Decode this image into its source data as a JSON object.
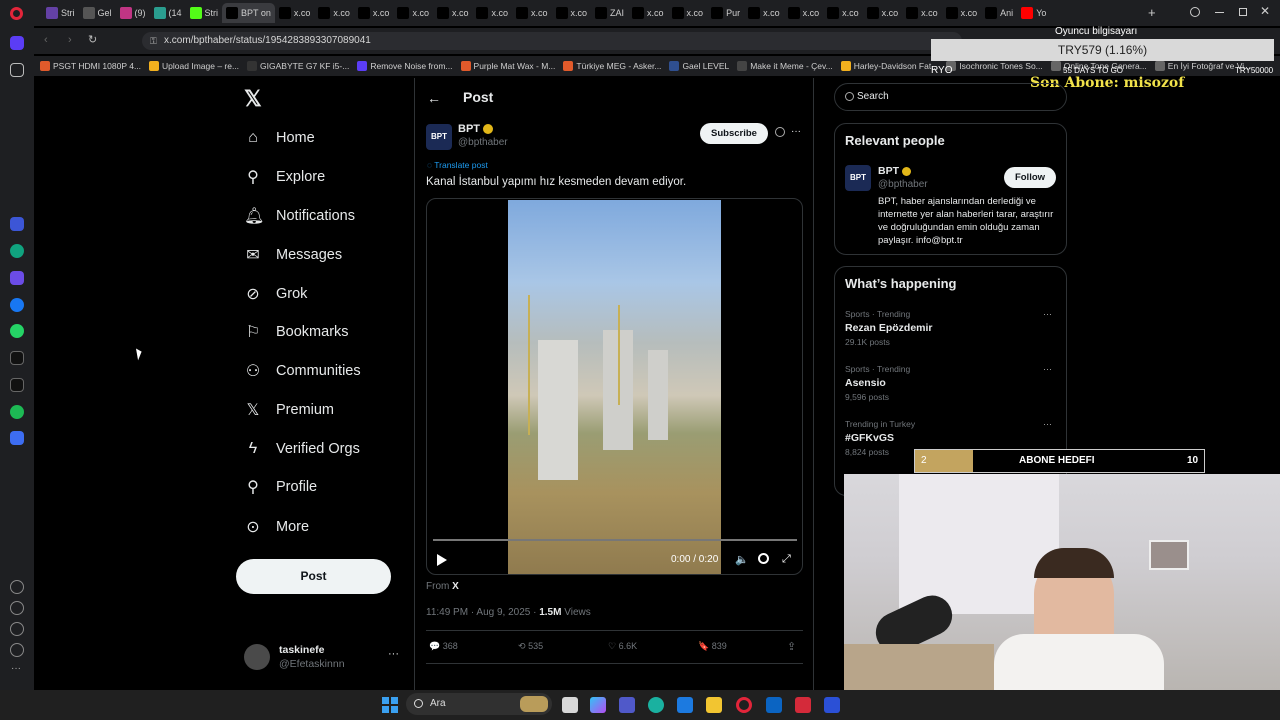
{
  "browser": {
    "tabs": [
      {
        "label": "Stri",
        "color": "#6441a5"
      },
      {
        "label": "Gel",
        "color": "#555"
      },
      {
        "label": "(9)",
        "color": "#c13584"
      },
      {
        "label": "(14",
        "color": "#2a9d8f"
      },
      {
        "label": "Stri",
        "color": "#53fc18"
      },
      {
        "label": "BPT on",
        "color": "#000"
      },
      {
        "label": "x.co",
        "color": "#000"
      },
      {
        "label": "x.co",
        "color": "#000"
      },
      {
        "label": "x.co",
        "color": "#000"
      },
      {
        "label": "x.co",
        "color": "#000"
      },
      {
        "label": "x.co",
        "color": "#000"
      },
      {
        "label": "x.co",
        "color": "#000"
      },
      {
        "label": "x.co",
        "color": "#000"
      },
      {
        "label": "x.co",
        "color": "#000"
      },
      {
        "label": "ZAI",
        "color": "#000"
      },
      {
        "label": "x.co",
        "color": "#000"
      },
      {
        "label": "x.co",
        "color": "#000"
      },
      {
        "label": "Pur",
        "color": "#000"
      },
      {
        "label": "x.co",
        "color": "#000"
      },
      {
        "label": "x.co",
        "color": "#000"
      },
      {
        "label": "x.co",
        "color": "#000"
      },
      {
        "label": "x.co",
        "color": "#000"
      },
      {
        "label": "x.co",
        "color": "#000"
      },
      {
        "label": "x.co",
        "color": "#000"
      },
      {
        "label": "Ani",
        "color": "#000"
      },
      {
        "label": "Yo",
        "color": "#ff0000"
      }
    ],
    "url": "x.com/bpthaber/status/1954283893307089041",
    "bookmarks": [
      {
        "label": "PSGT HDMI 1080P 4...",
        "color": "#e05a2b"
      },
      {
        "label": "Upload Image – re...",
        "color": "#f2b01e"
      },
      {
        "label": "GIGABYTE G7 KF i5-...",
        "color": "#333"
      },
      {
        "label": "Remove Noise from...",
        "color": "#5b3df5"
      },
      {
        "label": "Purple Mat Wax - M...",
        "color": "#e05a2b"
      },
      {
        "label": "Türkiye MEG - Asker...",
        "color": "#e05a2b"
      },
      {
        "label": "Gael LEVEL",
        "color": "#2f4f8f"
      },
      {
        "label": "Make it Meme - Çev...",
        "color": "#444"
      },
      {
        "label": "Harley-Davidson Fat...",
        "color": "#f2b01e"
      },
      {
        "label": "Isochronic Tones So...",
        "color": "#666"
      },
      {
        "label": "Online Tone Genera...",
        "color": "#666"
      },
      {
        "label": "En İyi Fotoğraf ve Vi...",
        "color": "#666"
      }
    ]
  },
  "stream_overlay": {
    "oyuncu": "Oyuncu bilgisayarı",
    "try_value": "TRY579 (1.16%)",
    "ryo": "RYO",
    "days_to_go": "55 DAYS TO GO",
    "try_goal": "TRY50000",
    "son_abone": "Son Abone: misozof",
    "abone_current": "2",
    "abone_label": "ABONE HEDEFI",
    "abone_target": "10",
    "abone_progress": 0.2
  },
  "nav": {
    "items": [
      {
        "label": "Home",
        "icon": "home-icon"
      },
      {
        "label": "Explore",
        "icon": "search-icon"
      },
      {
        "label": "Notifications",
        "icon": "bell-icon"
      },
      {
        "label": "Messages",
        "icon": "mail-icon"
      },
      {
        "label": "Grok",
        "icon": "grok-icon"
      },
      {
        "label": "Bookmarks",
        "icon": "bookmark-icon"
      },
      {
        "label": "Communities",
        "icon": "people-icon"
      },
      {
        "label": "Premium",
        "icon": "x-logo-icon"
      },
      {
        "label": "Verified Orgs",
        "icon": "lightning-icon"
      },
      {
        "label": "Profile",
        "icon": "user-icon"
      },
      {
        "label": "More",
        "icon": "more-circle-icon"
      }
    ],
    "post_button": "Post",
    "account": {
      "name": "taskinefe",
      "handle": "@Efetaskinnn"
    }
  },
  "post": {
    "header_title": "Post",
    "author_name": "BPT",
    "author_handle": "@bpthaber",
    "avatar_text": "BPT",
    "subscribe": "Subscribe",
    "translate": "Translate post",
    "text": "Kanal İstanbul yapımı hız kesmeden devam ediyor.",
    "video_time": "0:00 / 0:20",
    "from_label": "From",
    "from_source": "X",
    "timestamp": "11:49 PM · Aug 9, 2025 · ",
    "views_count": "1.5M",
    "views_label": " Views",
    "replies": "368",
    "reposts": "535",
    "likes": "6.6K",
    "bookmarks": "839"
  },
  "right": {
    "search_placeholder": "Search",
    "relevant_title": "Relevant people",
    "person": {
      "name": "BPT",
      "handle": "@bpthaber",
      "follow": "Follow",
      "bio": "BPT, haber ajanslarından derlediği ve internette yer alan haberleri tarar, araştırır ve doğruluğundan emin olduğu zaman paylaşır. info@bpt.tr"
    },
    "happening_title": "What’s happening",
    "trends": [
      {
        "context": "Sports · Trending",
        "name": "Rezan Epözdemir",
        "posts": "29.1K posts"
      },
      {
        "context": "Sports · Trending",
        "name": "Asensio",
        "posts": "9,596 posts"
      },
      {
        "context": "Trending in Turkey",
        "name": "#GFKvGS",
        "posts": "8,824 posts"
      }
    ]
  },
  "taskbar": {
    "search_label": "Ara"
  }
}
